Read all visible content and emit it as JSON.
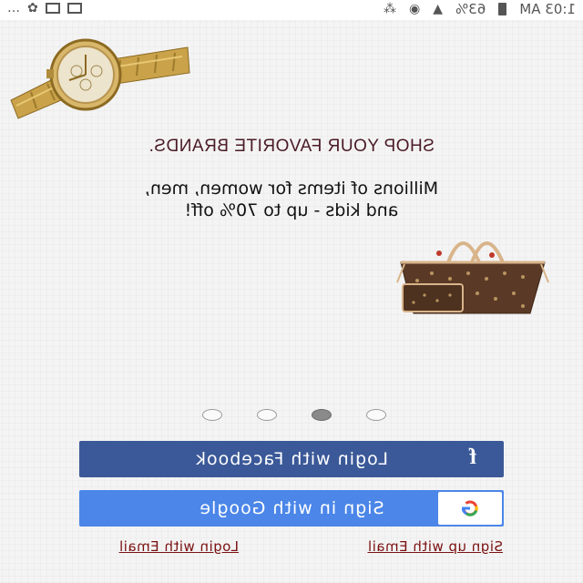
{
  "status_bar": {
    "time": "1:03 AM",
    "battery": "63%",
    "more": "…"
  },
  "promo": {
    "headline": "SHOP YOUR FAVORITE BRANDS.",
    "subline_1": "Millions of items for women, men,",
    "subline_2": "and kids - up to 70% off!",
    "images": [
      "gold-watch",
      "monogram-tote-bag"
    ]
  },
  "carousel": {
    "count": 4,
    "active_index": 2
  },
  "buttons": {
    "facebook_label": "Login with Facebook",
    "facebook_icon": "f",
    "google_label": "Sign in with Google",
    "google_icon": "G"
  },
  "links": {
    "signup_email": "Sign up with Email",
    "login_email": "Login with Email"
  },
  "colors": {
    "facebook": "#3b5998",
    "google": "#4b86e8",
    "link": "#7a1010",
    "headline": "#4a1a26"
  }
}
